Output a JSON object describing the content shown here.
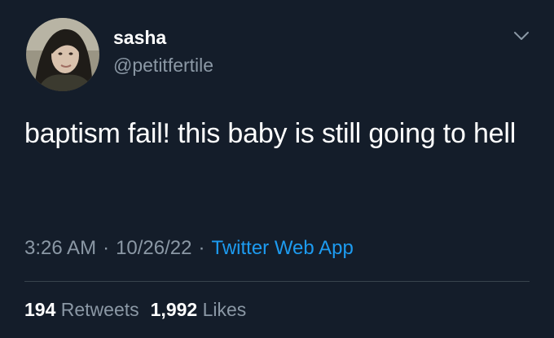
{
  "user": {
    "display_name": "sasha",
    "handle": "@petitfertile"
  },
  "tweet": {
    "text": "baptism fail! this baby is still going to hell",
    "time": "3:26 AM",
    "date": "10/26/22",
    "separator": "·",
    "source": "Twitter Web App"
  },
  "stats": {
    "retweets_count": "194",
    "retweets_label": "Retweets",
    "likes_count": "1,992",
    "likes_label": "Likes"
  },
  "icons": {
    "avatar": "profile-photo",
    "menu": "chevron-down-icon"
  },
  "colors": {
    "background": "#141d2a",
    "secondary_text": "#8b98a5",
    "link": "#1d9bf0",
    "divider": "#38444d"
  }
}
